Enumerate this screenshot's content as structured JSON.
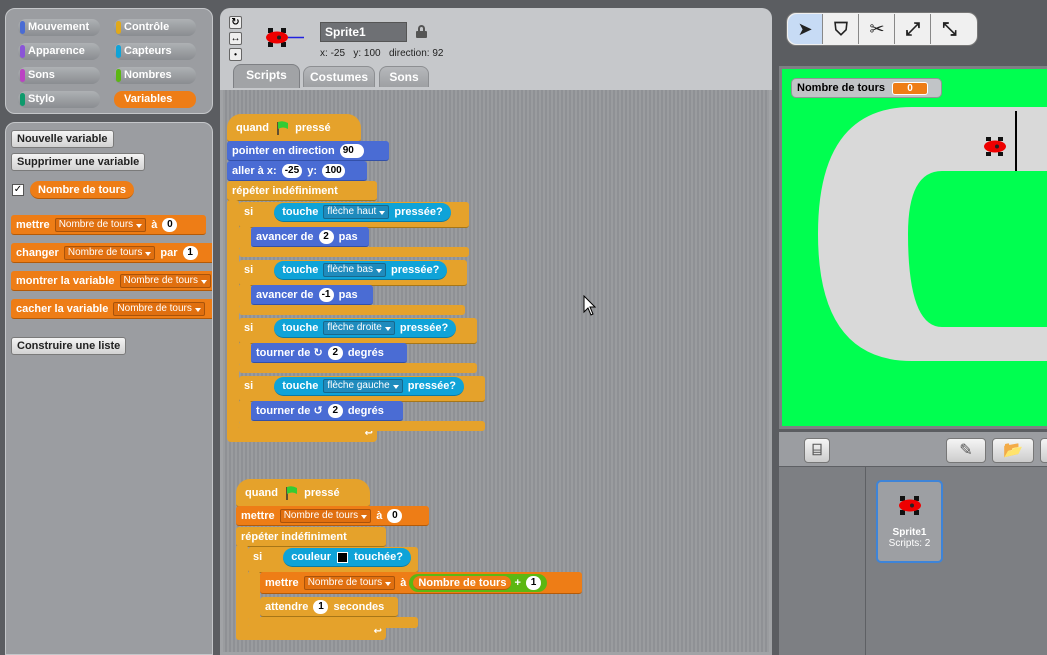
{
  "categories": [
    {
      "label": "Mouvement",
      "color": "#4a6cd4"
    },
    {
      "label": "Contrôle",
      "color": "#e1a91a"
    },
    {
      "label": "Apparence",
      "color": "#8a55d7"
    },
    {
      "label": "Capteurs",
      "color": "#0fa3d8"
    },
    {
      "label": "Sons",
      "color": "#bb42c3"
    },
    {
      "label": "Nombres",
      "color": "#5cb712"
    },
    {
      "label": "Stylo",
      "color": "#0e9a6c"
    },
    {
      "label": "Variables",
      "color": "#ee7d16"
    }
  ],
  "palette": {
    "new_var": "Nouvelle variable",
    "del_var": "Supprimer une variable",
    "var_name": "Nombre de tours",
    "set": "mettre",
    "change": "changer",
    "by": "par",
    "show_var": "montrer la variable",
    "hide_var": "cacher la variable",
    "to": "à",
    "zero": "0",
    "one": "1",
    "make_list": "Construire une liste"
  },
  "sprite": {
    "name": "Sprite1",
    "x_label": "x:",
    "x": "-25",
    "y_label": "y:",
    "y": "100",
    "dir_label": "direction:",
    "direction": "92"
  },
  "tabs": [
    "Scripts",
    "Costumes",
    "Sons"
  ],
  "script1": {
    "when": "quand",
    "clicked": "pressé",
    "point_dir": "pointer en direction",
    "point_val": "90",
    "goto": "aller à x:",
    "goto_x": "-25",
    "goto_y_label": "y:",
    "goto_y": "100",
    "forever": "répéter indéfiniment",
    "if": "si",
    "key": "touche",
    "pressed": "pressée?",
    "key_up": "flèche haut",
    "key_down": "flèche bas",
    "key_right": "flèche droite",
    "key_left": "flèche gauche",
    "move": "avancer de",
    "steps": "pas",
    "move_up": "2",
    "move_down": "-1",
    "turn": "tourner de",
    "degrees": "degrés",
    "turn_val": "2"
  },
  "script2": {
    "when": "quand",
    "clicked": "pressé",
    "set": "mettre",
    "var": "Nombre de tours",
    "to": "à",
    "zero": "0",
    "forever": "répéter indéfiniment",
    "if": "si",
    "color": "couleur",
    "touched": "touchée?",
    "var_reporter": "Nombre de tours",
    "plus": "+",
    "one": "1",
    "wait": "attendre",
    "wait_val": "1",
    "seconds": "secondes"
  },
  "stage": {
    "monitor_label": "Nombre de tours",
    "monitor_value": "0",
    "track_color": "#d9d9d9",
    "grass_color": "#00ff50"
  },
  "sprite_card": {
    "name": "Sprite1",
    "scripts": "Scripts: 2"
  }
}
